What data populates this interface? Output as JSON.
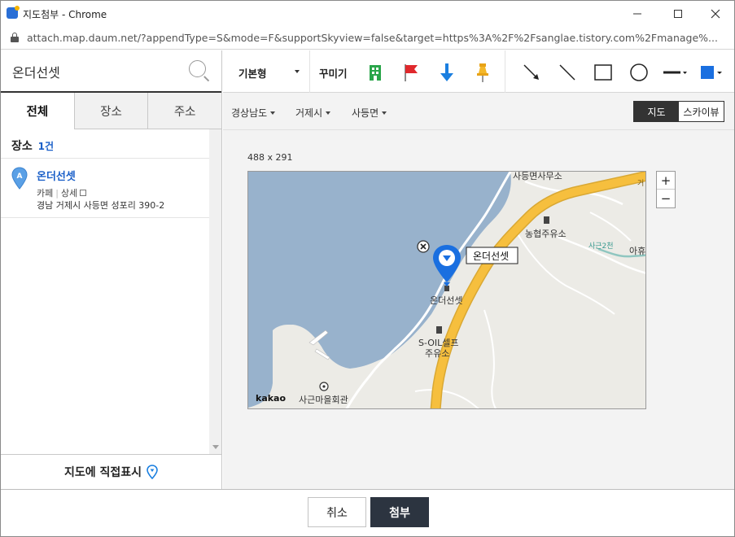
{
  "window": {
    "title": "지도첨부 - Chrome",
    "url": "attach.map.daum.net/?appendType=S&mode=F&supportSkyview=false&target=https%3A%2F%2Fsanglae.tistory.com%2Fmanage%..."
  },
  "search": {
    "value": "온더선셋"
  },
  "tabs": [
    {
      "label": "전체",
      "active": true
    },
    {
      "label": "장소",
      "active": false
    },
    {
      "label": "주소",
      "active": false
    }
  ],
  "results": {
    "heading": "장소",
    "count": "1건",
    "items": [
      {
        "marker": "A",
        "name": "온더선셋",
        "category": "카페",
        "detail_link": "상세",
        "address": "경남 거제시 사등면 성포리 390-2"
      }
    ]
  },
  "direct_mark_label": "지도에 직접표시",
  "toolbar": {
    "basic_label": "기본형",
    "decorate_label": "꾸미기",
    "tools": [
      "building-icon",
      "flag-icon",
      "arrow-down-icon",
      "pushpin-icon",
      "arrow-line-icon",
      "line-icon",
      "rectangle-icon",
      "circle-icon",
      "line-style-icon",
      "color-picker-icon"
    ],
    "accent_color": "#1a6fe0"
  },
  "regions": [
    "경상남도",
    "거제시",
    "사등면"
  ],
  "map_type": {
    "map": "지도",
    "skyview": "스카이뷰",
    "selected": "지도"
  },
  "map": {
    "size_label": "488 x 291",
    "brand": "kakao",
    "marker_label": "온더선셋",
    "labels": {
      "top": "사등면사무소",
      "gas1": "농협주유소",
      "stream": "사근2천",
      "edge": "아휴",
      "poi": "온더선셋",
      "gas2a": "S-OIL셀프",
      "gas2b": "주유소",
      "hall": "사근마을회관",
      "road_edge": "거"
    },
    "colors": {
      "sea": "#98b2cc",
      "land": "#ecebe6",
      "road": "#f6bf3e",
      "marker": "#1a6fe0"
    }
  },
  "zoom": {
    "in": "+",
    "out": "−"
  },
  "buttons": {
    "cancel": "취소",
    "attach": "첨부"
  }
}
